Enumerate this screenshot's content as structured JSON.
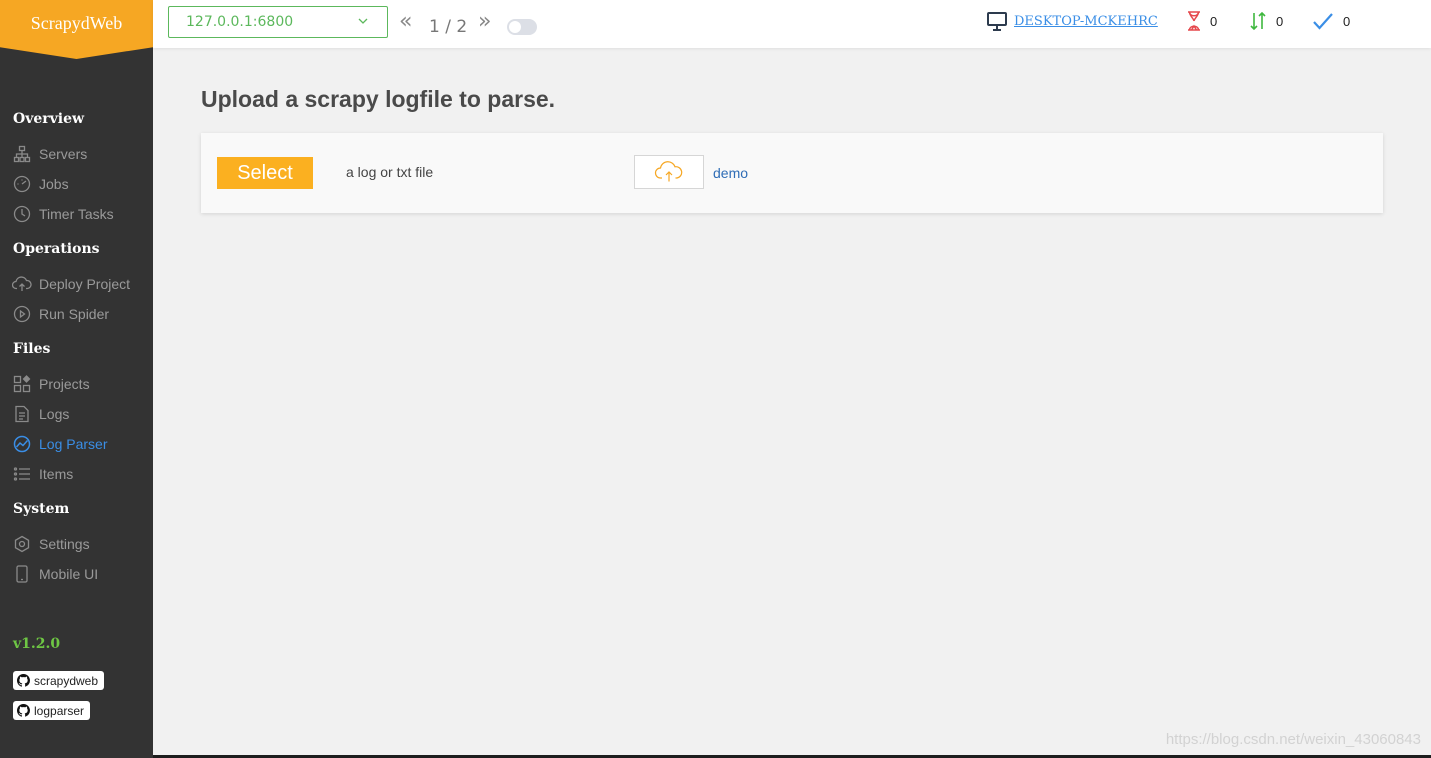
{
  "app": {
    "title": "ScrapydWeb",
    "version": "v1.2.0"
  },
  "sidebar": {
    "sections": [
      {
        "title": "Overview"
      },
      {
        "title": "Operations"
      },
      {
        "title": "Files"
      },
      {
        "title": "System"
      }
    ],
    "items": [
      {
        "label": "Servers",
        "icon": "servers-icon"
      },
      {
        "label": "Jobs",
        "icon": "jobs-icon"
      },
      {
        "label": "Timer Tasks",
        "icon": "timer-icon"
      },
      {
        "label": "Deploy Project",
        "icon": "upload-cloud-icon"
      },
      {
        "label": "Run Spider",
        "icon": "play-icon"
      },
      {
        "label": "Projects",
        "icon": "projects-icon"
      },
      {
        "label": "Logs",
        "icon": "document-icon"
      },
      {
        "label": "Log Parser",
        "icon": "chart-icon",
        "active": true
      },
      {
        "label": "Items",
        "icon": "list-icon"
      },
      {
        "label": "Settings",
        "icon": "settings-icon"
      },
      {
        "label": "Mobile UI",
        "icon": "mobile-icon"
      }
    ],
    "badges": [
      {
        "label": "scrapydweb",
        "icon": "github-icon"
      },
      {
        "label": "logparser",
        "icon": "github-icon"
      }
    ]
  },
  "topbar": {
    "server": "127.0.0.1:6800",
    "pager": "1 / 2",
    "prev": "«",
    "next": "»",
    "host": "DESKTOP-MCKEHRC",
    "stats": {
      "pending": "0",
      "running": "0",
      "finished": "0"
    }
  },
  "main": {
    "title": "Upload a scrapy logfile to parse.",
    "select_label": "Select",
    "hint": "a log or txt file",
    "demo_label": "demo"
  },
  "watermark": "https://blog.csdn.net/weixin_43060843",
  "colors": {
    "accent": "#f6a723",
    "sidebar_bg": "#333333",
    "active": "#3a8ee6",
    "server_green": "#5cb85c",
    "version_green": "#6ec644"
  }
}
